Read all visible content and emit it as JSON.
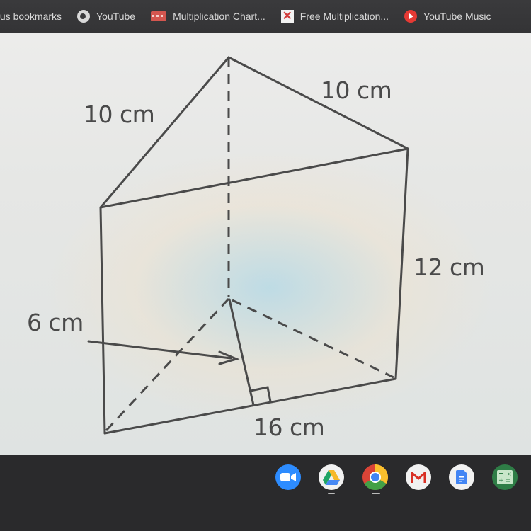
{
  "bookmarks_bar": {
    "items": [
      {
        "label": ".us bookmarks",
        "icon": "none"
      },
      {
        "label": "YouTube",
        "icon": "globe-icon"
      },
      {
        "label": "Multiplication Chart...",
        "icon": "multiplication-chart-icon"
      },
      {
        "label": "Free Multiplication...",
        "icon": "red-x-icon"
      },
      {
        "label": "YouTube Music",
        "icon": "youtube-music-icon"
      }
    ]
  },
  "diagram": {
    "title": "Triangular prism",
    "labels": {
      "slant_left": "10 cm",
      "slant_right": "10 cm",
      "prism_length": "12 cm",
      "triangle_height": "6 cm",
      "triangle_base": "16 cm"
    },
    "colors": {
      "line": "#4a4a4a"
    }
  },
  "taskbar": {
    "apps": [
      {
        "name": "Zoom",
        "icon": "zoom-camera-icon",
        "color": "#2d8cff",
        "active": false
      },
      {
        "name": "Google Drive",
        "icon": "drive-icon",
        "color": "#ffffff",
        "active": true
      },
      {
        "name": "Chrome",
        "icon": "chrome-icon",
        "color": "#ffffff",
        "active": true
      },
      {
        "name": "Gmail",
        "icon": "gmail-icon",
        "color": "#ffffff",
        "active": false
      },
      {
        "name": "Google Docs",
        "icon": "docs-icon",
        "color": "#ffffff",
        "active": false
      },
      {
        "name": "Calculator",
        "icon": "calculator-icon",
        "color": "#2e7d46",
        "active": false
      }
    ]
  }
}
